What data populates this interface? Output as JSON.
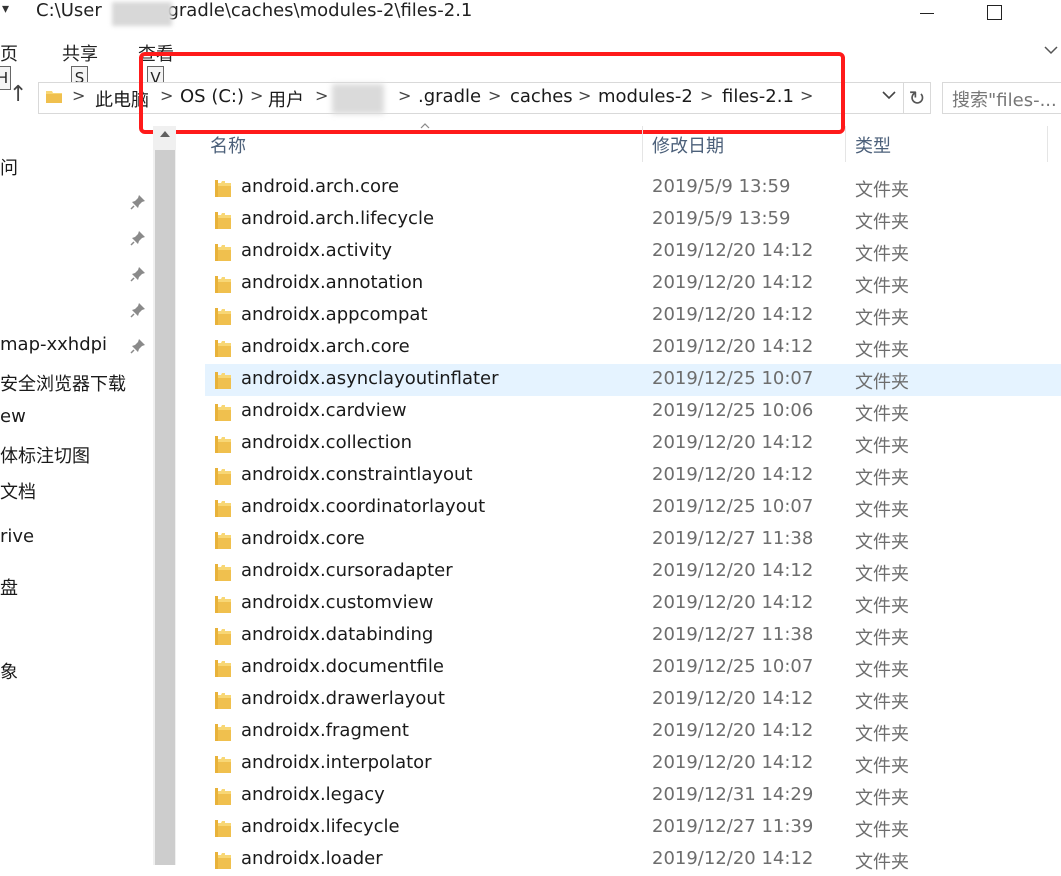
{
  "window": {
    "title_prefix": "C:\\User",
    "title_suffix": ".gradle\\caches\\modules-2\\files-2.1",
    "menu_arrow": "▾"
  },
  "ribbon": {
    "tabs": [
      {
        "label": "主页",
        "visible_label": "页",
        "keytip": "H"
      },
      {
        "label": "共享",
        "keytip": "S"
      },
      {
        "label": "查看",
        "keytip": "V"
      }
    ]
  },
  "address": {
    "up_glyph": "↑",
    "crumbs": [
      "此电脑",
      "OS (C:)",
      "用户",
      ".gradle",
      "caches",
      "modules-2",
      "files-2.1"
    ],
    "separator": ">",
    "dropdown_glyph": "⌵",
    "refresh_glyph": "↻"
  },
  "search": {
    "placeholder": "搜索\"files-..."
  },
  "sidebar": {
    "items": [
      {
        "label": "问"
      },
      {
        "label": "map-xxhdpi"
      },
      {
        "label": "安全浏览器下载"
      },
      {
        "label": "ew"
      },
      {
        "label": "体标注切图"
      },
      {
        "label": "文档"
      },
      {
        "label": "rive"
      },
      {
        "label": "盘"
      },
      {
        "label": "象"
      }
    ]
  },
  "columns": {
    "name": "名称",
    "date": "修改日期",
    "type": "类型"
  },
  "files": [
    {
      "name": "android.arch.core",
      "date": "2019/5/9 13:59",
      "type": "文件夹"
    },
    {
      "name": "android.arch.lifecycle",
      "date": "2019/5/9 13:59",
      "type": "文件夹"
    },
    {
      "name": "androidx.activity",
      "date": "2019/12/20 14:12",
      "type": "文件夹"
    },
    {
      "name": "androidx.annotation",
      "date": "2019/12/20 14:12",
      "type": "文件夹"
    },
    {
      "name": "androidx.appcompat",
      "date": "2019/12/20 14:12",
      "type": "文件夹"
    },
    {
      "name": "androidx.arch.core",
      "date": "2019/12/20 14:12",
      "type": "文件夹"
    },
    {
      "name": "androidx.asynclayoutinflater",
      "date": "2019/12/25 10:07",
      "type": "文件夹",
      "selected": true
    },
    {
      "name": "androidx.cardview",
      "date": "2019/12/25 10:06",
      "type": "文件夹"
    },
    {
      "name": "androidx.collection",
      "date": "2019/12/20 14:12",
      "type": "文件夹"
    },
    {
      "name": "androidx.constraintlayout",
      "date": "2019/12/20 14:12",
      "type": "文件夹"
    },
    {
      "name": "androidx.coordinatorlayout",
      "date": "2019/12/25 10:07",
      "type": "文件夹"
    },
    {
      "name": "androidx.core",
      "date": "2019/12/27 11:38",
      "type": "文件夹"
    },
    {
      "name": "androidx.cursoradapter",
      "date": "2019/12/20 14:12",
      "type": "文件夹"
    },
    {
      "name": "androidx.customview",
      "date": "2019/12/20 14:12",
      "type": "文件夹"
    },
    {
      "name": "androidx.databinding",
      "date": "2019/12/27 11:38",
      "type": "文件夹"
    },
    {
      "name": "androidx.documentfile",
      "date": "2019/12/25 10:07",
      "type": "文件夹"
    },
    {
      "name": "androidx.drawerlayout",
      "date": "2019/12/20 14:12",
      "type": "文件夹"
    },
    {
      "name": "androidx.fragment",
      "date": "2019/12/20 14:12",
      "type": "文件夹"
    },
    {
      "name": "androidx.interpolator",
      "date": "2019/12/20 14:12",
      "type": "文件夹"
    },
    {
      "name": "androidx.legacy",
      "date": "2019/12/31 14:29",
      "type": "文件夹"
    },
    {
      "name": "androidx.lifecycle",
      "date": "2019/12/27 11:39",
      "type": "文件夹"
    },
    {
      "name": "androidx.loader",
      "date": "2019/12/20 14:12",
      "type": "文件夹"
    }
  ],
  "colors": {
    "selection": "#e5f3ff",
    "highlight_border": "#ff1a1a",
    "folder": "#f8d775",
    "column_header_text": "#4c607a"
  }
}
